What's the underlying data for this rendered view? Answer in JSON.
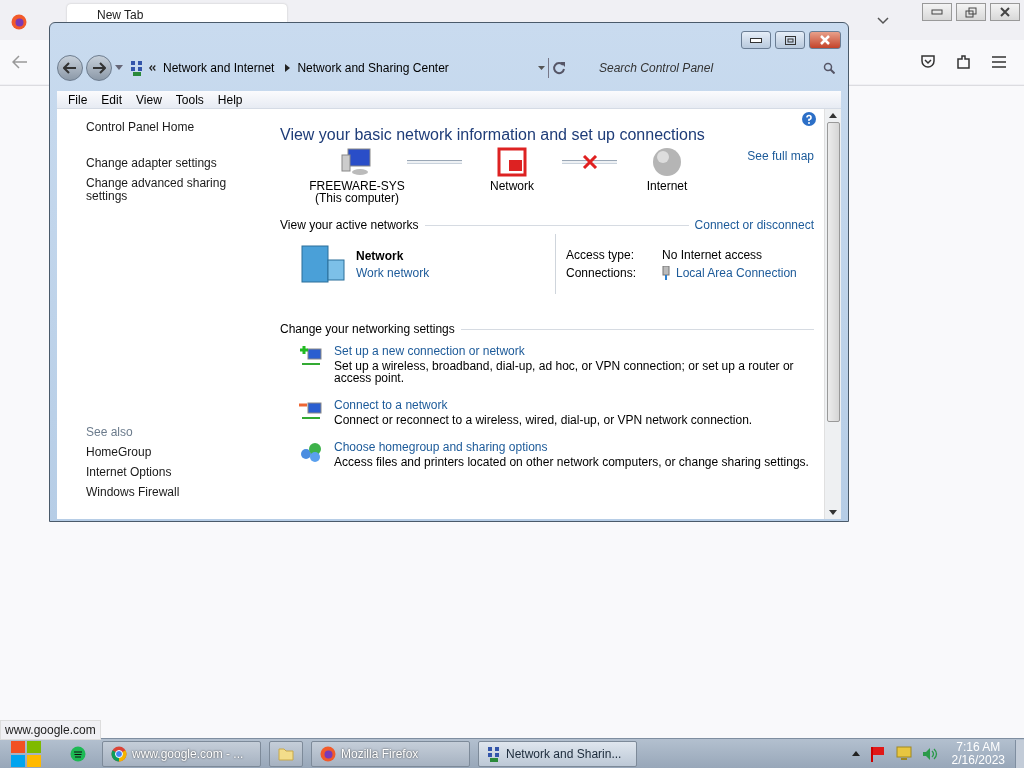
{
  "browser": {
    "tab": {
      "label": "New Tab"
    },
    "status_text": "www.google.com"
  },
  "window": {
    "breadcrumb": [
      "Network and Internet",
      "Network and Sharing Center"
    ],
    "search": {
      "placeholder": "Search Control Panel"
    },
    "menu": [
      "File",
      "Edit",
      "View",
      "Tools",
      "Help"
    ]
  },
  "sidebar": {
    "items": [
      "Control Panel Home",
      "Change adapter settings",
      "Change advanced sharing settings"
    ],
    "see_also_title": "See also",
    "see_also": [
      "HomeGroup",
      "Internet Options",
      "Windows Firewall"
    ]
  },
  "main": {
    "title": "View your basic network information and set up connections",
    "see_full_map": "See full map",
    "map_nodes": [
      {
        "kind": "computer",
        "label": "FREEWARE-SYS",
        "sublabel": "(This computer)"
      },
      {
        "kind": "network",
        "label": "Network"
      },
      {
        "kind": "internet",
        "label": "Internet"
      }
    ],
    "map_links": [
      {
        "connected": true
      },
      {
        "connected": false
      }
    ],
    "active_networks": {
      "heading": "View your active networks",
      "action": "Connect or disconnect",
      "name": "Network",
      "type": "Work network",
      "access_type_label": "Access type:",
      "access_type": "No Internet access",
      "connections_label": "Connections:",
      "connection": "Local Area Connection"
    },
    "settings": {
      "heading": "Change your networking settings",
      "tasks": [
        {
          "kind": "new-connection",
          "title": "Set up a new connection or network",
          "description": "Set up a wireless, broadband, dial-up, ad hoc, or VPN connection; or set up a router or access point."
        },
        {
          "kind": "connect",
          "title": "Connect to a network",
          "description": "Connect or reconnect to a wireless, wired, dial-up, or VPN network connection."
        },
        {
          "kind": "homegroup",
          "title": "Choose homegroup and sharing options",
          "description": "Access files and printers located on other network computers, or change sharing settings."
        }
      ]
    }
  },
  "taskbar": {
    "items": [
      {
        "kind": "chrome",
        "label": "www.google.com - ...",
        "selected": false
      },
      {
        "kind": "folder",
        "selected": false
      },
      {
        "kind": "firefox",
        "label": "Mozilla Firefox",
        "selected": false
      },
      {
        "kind": "network",
        "label": "Network and Sharin...",
        "selected": true
      }
    ],
    "time": "7:16 AM",
    "date": "2/16/2023"
  }
}
